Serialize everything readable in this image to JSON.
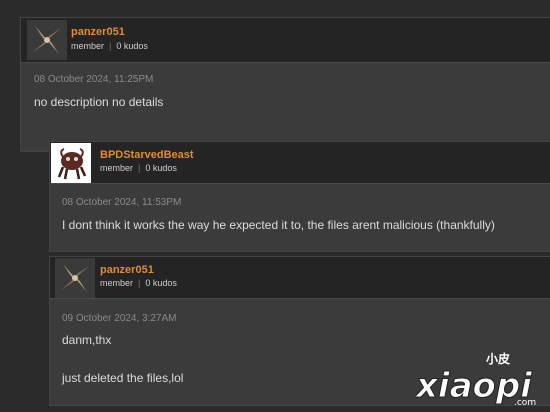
{
  "comments": [
    {
      "username": "panzer051",
      "role": "member",
      "kudos": "0 kudos",
      "date": "08 October 2024, 11:25PM",
      "body": [
        "no description no details"
      ]
    },
    {
      "username": "BPDStarvedBeast",
      "role": "member",
      "kudos": "0 kudos",
      "date": "08 October 2024, 11:53PM",
      "body": [
        "I dont think it works the way he expected it to, the files arent malicious (thankfully)"
      ]
    },
    {
      "username": "panzer051",
      "role": "member",
      "kudos": "0 kudos",
      "date": "09 October 2024, 3:27AM",
      "body": [
        "danm,thx",
        "just deleted the files,lol"
      ]
    }
  ],
  "watermark": {
    "top": "小皮",
    "main": "xiaopi",
    "domain": ".com"
  },
  "colors": {
    "username": "#e08b35",
    "header_bg": "#242424",
    "body_bg": "#3b3b3b",
    "page_bg": "#2b2b2b"
  }
}
